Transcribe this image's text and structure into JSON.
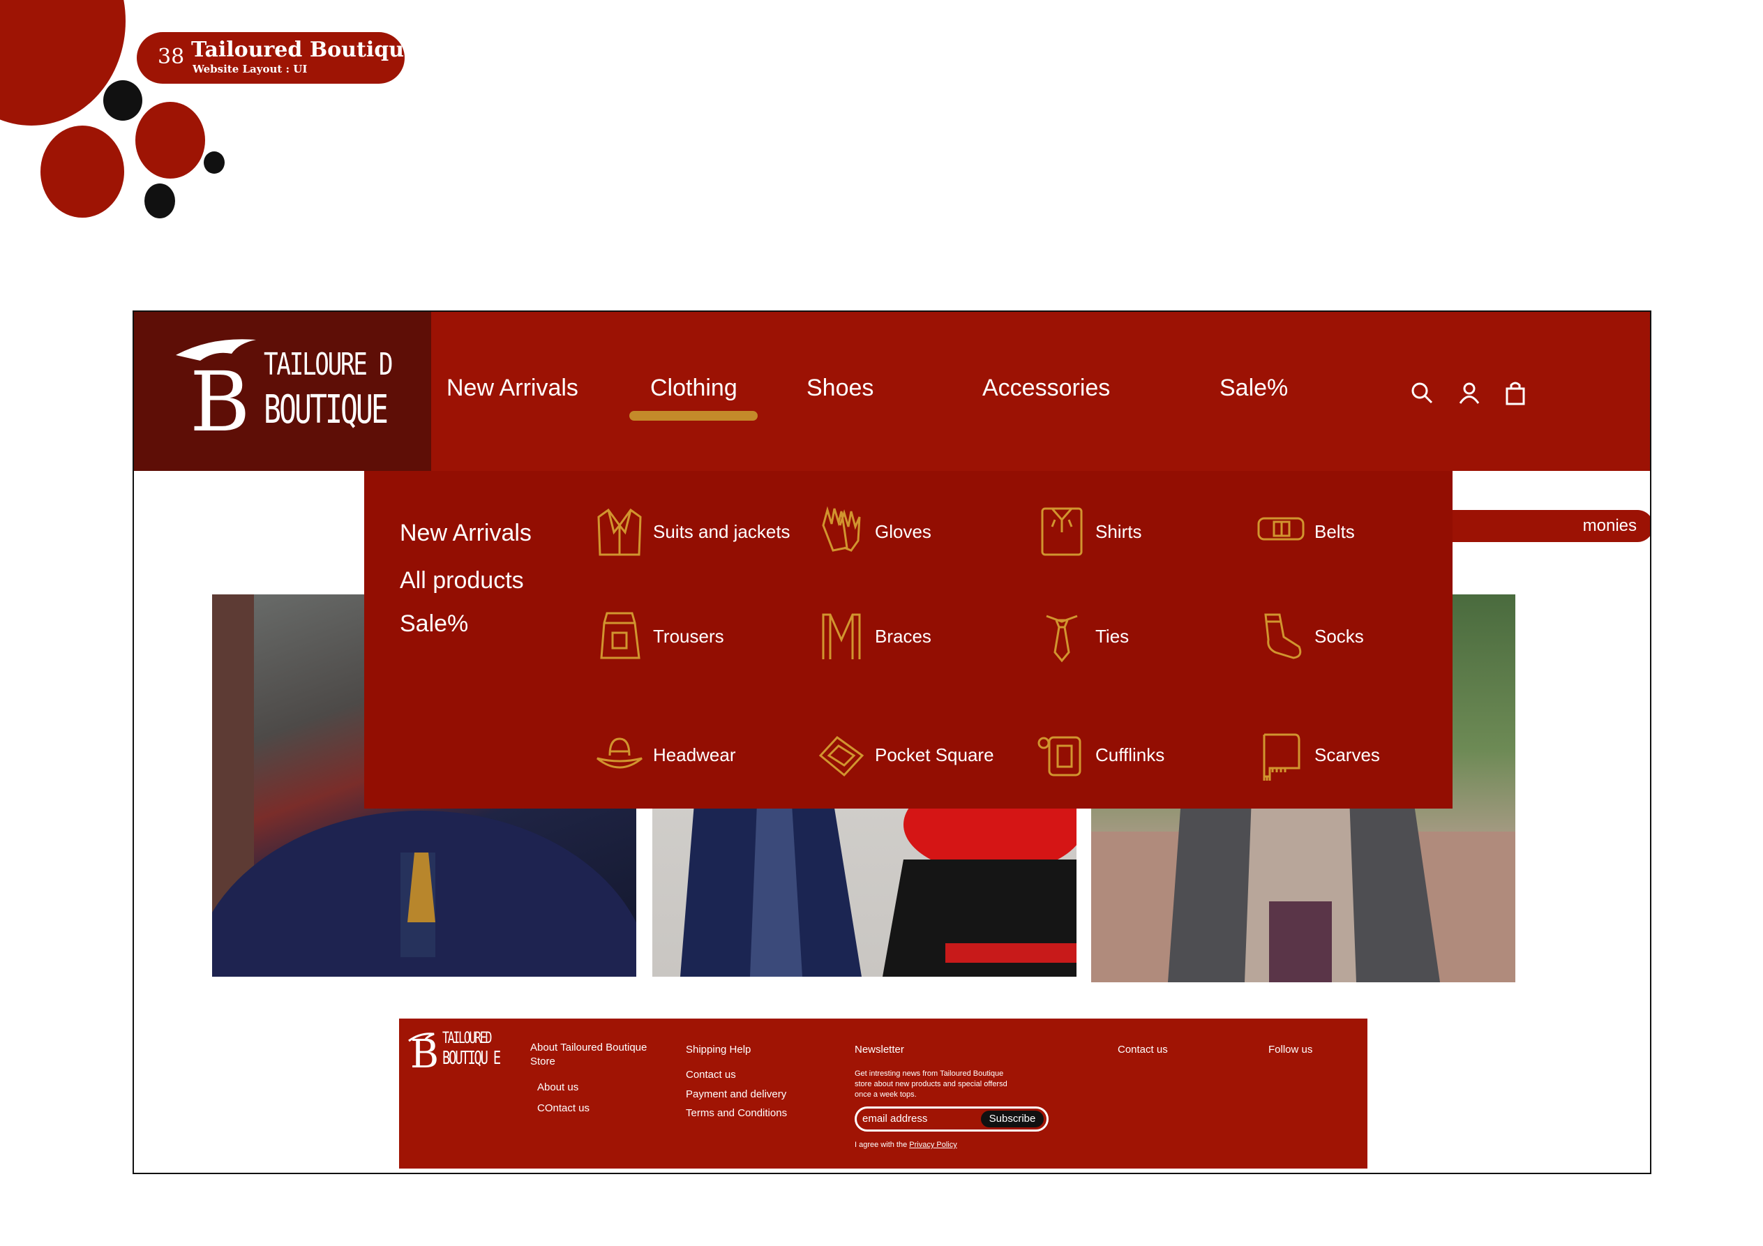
{
  "deck": {
    "page_number": "38",
    "title": "Tailoured  Boutique",
    "subtitle": "Website Layout : UI"
  },
  "brand": {
    "initial": "B",
    "line1": "TAILOURE D",
    "line2": "BOUTIQUE",
    "footer_line1": "TAILOURED",
    "footer_line2": "BOUTIQU E"
  },
  "nav": {
    "items": [
      "New Arrivals",
      "Clothing",
      "Shoes",
      "Accessories",
      "Sale%"
    ],
    "active": "Clothing",
    "icons": [
      "search-icon",
      "user-icon",
      "bag-icon"
    ]
  },
  "dropdown": {
    "side_links": [
      "New Arrivals",
      "All products",
      "Sale%"
    ],
    "categories": [
      {
        "label": "Suits and jackets",
        "icon": "jacket-icon"
      },
      {
        "label": "Gloves",
        "icon": "gloves-icon"
      },
      {
        "label": "Shirts",
        "icon": "shirt-icon"
      },
      {
        "label": "Belts",
        "icon": "belt-icon"
      },
      {
        "label": "Trousers",
        "icon": "trousers-icon"
      },
      {
        "label": "Braces",
        "icon": "braces-icon"
      },
      {
        "label": "Ties",
        "icon": "tie-icon"
      },
      {
        "label": "Socks",
        "icon": "sock-icon"
      },
      {
        "label": "Headwear",
        "icon": "hat-icon"
      },
      {
        "label": "Pocket Square",
        "icon": "pocket-square-icon"
      },
      {
        "label": "Cufflinks",
        "icon": "cufflinks-icon"
      },
      {
        "label": "Scarves",
        "icon": "scarf-icon"
      }
    ]
  },
  "hero": {
    "tag_partial": "monies"
  },
  "footer": {
    "about_heading": "About Tailoured Boutique Store",
    "about_links": [
      "About us",
      "COntact us"
    ],
    "shipping_heading": "Shipping Help",
    "shipping_links": [
      "Contact us",
      "Payment and delivery",
      "Terms and Conditions"
    ],
    "newsletter_heading": "Newsletter",
    "newsletter_text": "Get intresting news  from Tailoured Boutique store about new products and special offersd once a week tops.",
    "email_placeholder": "email address",
    "subscribe_label": "Subscribe",
    "agree_text": "I agree with the",
    "privacy_link": "Privacy Policy",
    "contact_heading": "Contact us",
    "follow_heading": "Follow us"
  },
  "colors": {
    "brand_red": "#9c1204",
    "dark_maroon": "#5e0e06",
    "dropdown_red": "#930e02",
    "gold_accent": "#c48a2a"
  }
}
